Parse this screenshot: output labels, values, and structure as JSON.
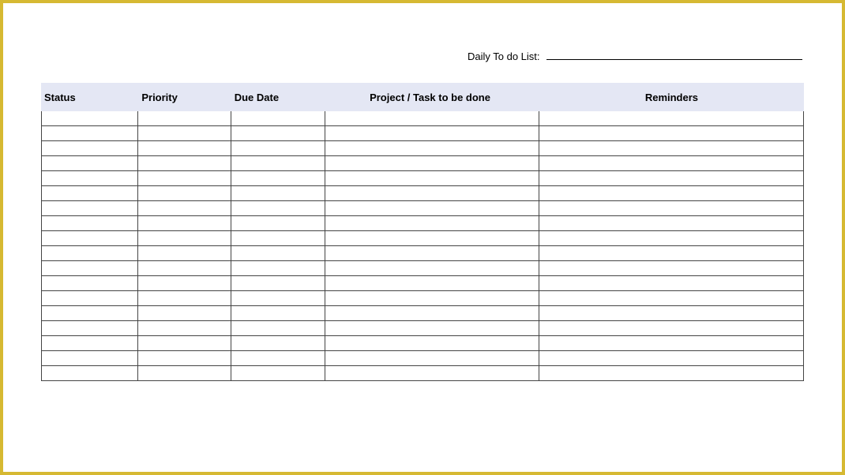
{
  "header": {
    "label": "Daily To do List:",
    "value": ""
  },
  "table": {
    "columns": [
      {
        "key": "status",
        "label": "Status"
      },
      {
        "key": "priority",
        "label": "Priority"
      },
      {
        "key": "duedate",
        "label": "Due Date"
      },
      {
        "key": "project",
        "label": "Project / Task to be done"
      },
      {
        "key": "reminders",
        "label": "Reminders"
      }
    ],
    "rows": [
      {
        "status": "",
        "priority": "",
        "duedate": "",
        "project": "",
        "reminders": ""
      },
      {
        "status": "",
        "priority": "",
        "duedate": "",
        "project": "",
        "reminders": ""
      },
      {
        "status": "",
        "priority": "",
        "duedate": "",
        "project": "",
        "reminders": ""
      },
      {
        "status": "",
        "priority": "",
        "duedate": "",
        "project": "",
        "reminders": ""
      },
      {
        "status": "",
        "priority": "",
        "duedate": "",
        "project": "",
        "reminders": ""
      },
      {
        "status": "",
        "priority": "",
        "duedate": "",
        "project": "",
        "reminders": ""
      },
      {
        "status": "",
        "priority": "",
        "duedate": "",
        "project": "",
        "reminders": ""
      },
      {
        "status": "",
        "priority": "",
        "duedate": "",
        "project": "",
        "reminders": ""
      },
      {
        "status": "",
        "priority": "",
        "duedate": "",
        "project": "",
        "reminders": ""
      },
      {
        "status": "",
        "priority": "",
        "duedate": "",
        "project": "",
        "reminders": ""
      },
      {
        "status": "",
        "priority": "",
        "duedate": "",
        "project": "",
        "reminders": ""
      },
      {
        "status": "",
        "priority": "",
        "duedate": "",
        "project": "",
        "reminders": ""
      },
      {
        "status": "",
        "priority": "",
        "duedate": "",
        "project": "",
        "reminders": ""
      },
      {
        "status": "",
        "priority": "",
        "duedate": "",
        "project": "",
        "reminders": ""
      },
      {
        "status": "",
        "priority": "",
        "duedate": "",
        "project": "",
        "reminders": ""
      },
      {
        "status": "",
        "priority": "",
        "duedate": "",
        "project": "",
        "reminders": ""
      },
      {
        "status": "",
        "priority": "",
        "duedate": "",
        "project": "",
        "reminders": ""
      },
      {
        "status": "",
        "priority": "",
        "duedate": "",
        "project": "",
        "reminders": ""
      }
    ]
  }
}
